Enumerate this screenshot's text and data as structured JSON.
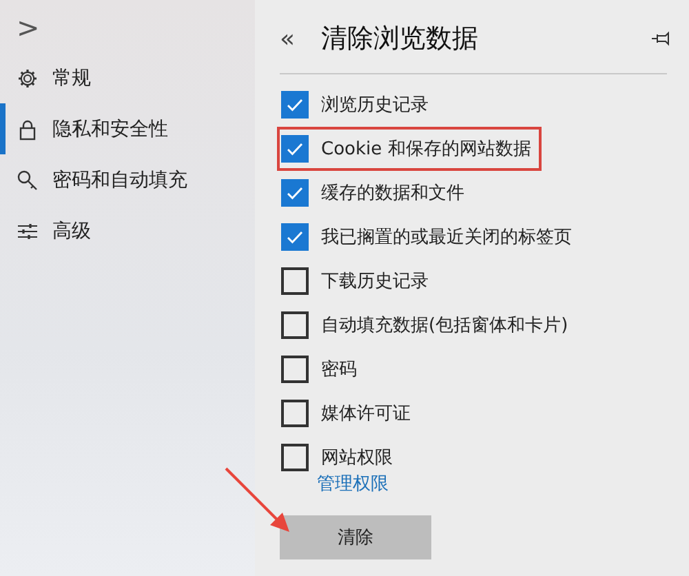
{
  "sidebar": {
    "expand_glyph": ">",
    "items": [
      {
        "label": "常规",
        "selected": false
      },
      {
        "label": "隐私和安全性",
        "selected": true
      },
      {
        "label": "密码和自动填充",
        "selected": false
      },
      {
        "label": "高级",
        "selected": false
      }
    ]
  },
  "panel": {
    "back_glyph": "«",
    "title": "清除浏览数据",
    "options": [
      {
        "label": "浏览历史记录",
        "checked": true,
        "highlighted": false
      },
      {
        "label": "Cookie 和保存的网站数据",
        "checked": true,
        "highlighted": true
      },
      {
        "label": "缓存的数据和文件",
        "checked": true,
        "highlighted": false
      },
      {
        "label": "我已搁置的或最近关闭的标签页",
        "checked": true,
        "highlighted": false
      },
      {
        "label": "下载历史记录",
        "checked": false,
        "highlighted": false
      },
      {
        "label": "自动填充数据(包括窗体和卡片)",
        "checked": false,
        "highlighted": false
      },
      {
        "label": "密码",
        "checked": false,
        "highlighted": false
      },
      {
        "label": "媒体许可证",
        "checked": false,
        "highlighted": false
      },
      {
        "label": "网站权限",
        "checked": false,
        "highlighted": false
      }
    ],
    "link": "管理权限",
    "button": "清除"
  }
}
